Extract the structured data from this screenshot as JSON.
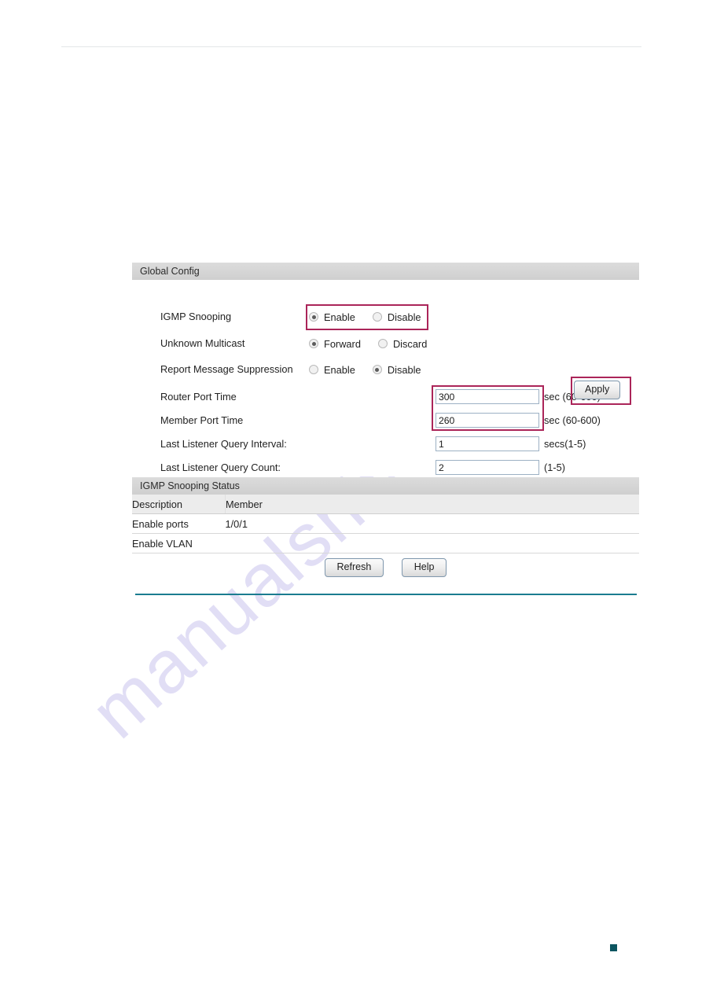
{
  "colors": {
    "highlight": "#ab2559",
    "teal_rule": "#1b7c90",
    "marker": "#0c5560",
    "section_header_bg": "#d4d4d4",
    "watermark": "#c9c4ee"
  },
  "watermark": {
    "text": "manualshive.com"
  },
  "global_config": {
    "section_title": "Global Config",
    "rows": [
      {
        "label": "IGMP Snooping",
        "type": "radio",
        "options": [
          {
            "label": "Enable",
            "selected": true
          },
          {
            "label": "Disable",
            "selected": false
          }
        ],
        "highlighted": true
      },
      {
        "label": "Unknown Multicast",
        "type": "radio",
        "options": [
          {
            "label": "Forward",
            "selected": true
          },
          {
            "label": "Discard",
            "selected": false
          }
        ],
        "highlighted": false
      },
      {
        "label": "Report Message Suppression",
        "type": "radio",
        "options": [
          {
            "label": "Enable",
            "selected": false
          },
          {
            "label": "Disable",
            "selected": true
          }
        ],
        "highlighted": false
      },
      {
        "label": "Router Port Time",
        "type": "text",
        "value": "300",
        "unit": "sec (60-600)",
        "highlighted": true
      },
      {
        "label": "Member Port Time",
        "type": "text",
        "value": "260",
        "unit": "sec (60-600)",
        "highlighted": true
      },
      {
        "label": "Last Listener Query Interval:",
        "type": "text",
        "value": "1",
        "unit": "secs(1-5)",
        "highlighted": false
      },
      {
        "label": "Last Listener Query Count:",
        "type": "text",
        "value": "2",
        "unit": "(1-5)",
        "highlighted": false
      }
    ],
    "apply_label": "Apply"
  },
  "status": {
    "section_title": "IGMP Snooping Status",
    "columns": [
      "Description",
      "Member"
    ],
    "rows": [
      {
        "description": "Enable ports",
        "member": "1/0/1"
      },
      {
        "description": "Enable VLAN",
        "member": ""
      }
    ]
  },
  "footer_buttons": {
    "refresh_label": "Refresh",
    "help_label": "Help"
  }
}
